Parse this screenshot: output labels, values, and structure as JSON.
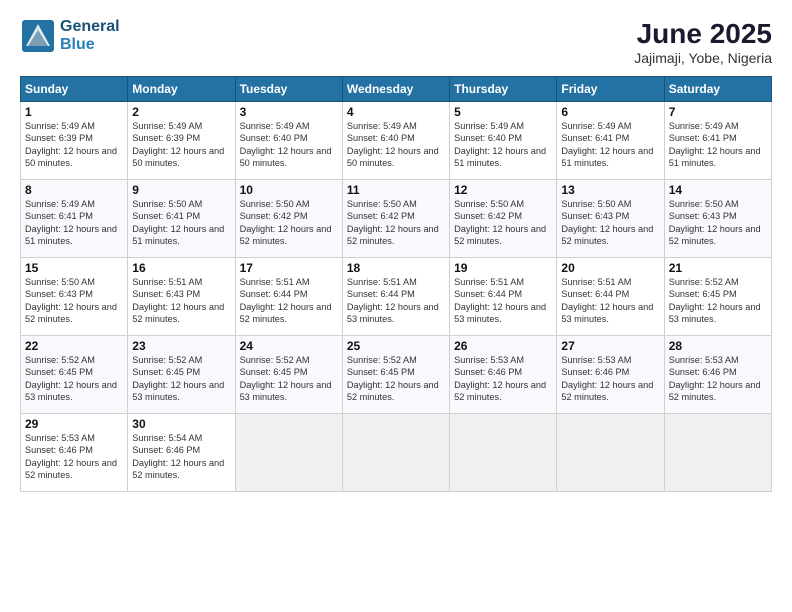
{
  "header": {
    "logo_line1": "General",
    "logo_line2": "Blue",
    "month_year": "June 2025",
    "location": "Jajimaji, Yobe, Nigeria"
  },
  "days_of_week": [
    "Sunday",
    "Monday",
    "Tuesday",
    "Wednesday",
    "Thursday",
    "Friday",
    "Saturday"
  ],
  "weeks": [
    [
      {
        "num": "1",
        "rise": "5:49 AM",
        "set": "6:39 PM",
        "daylight": "12 hours and 50 minutes"
      },
      {
        "num": "2",
        "rise": "5:49 AM",
        "set": "6:39 PM",
        "daylight": "12 hours and 50 minutes"
      },
      {
        "num": "3",
        "rise": "5:49 AM",
        "set": "6:40 PM",
        "daylight": "12 hours and 50 minutes"
      },
      {
        "num": "4",
        "rise": "5:49 AM",
        "set": "6:40 PM",
        "daylight": "12 hours and 50 minutes"
      },
      {
        "num": "5",
        "rise": "5:49 AM",
        "set": "6:40 PM",
        "daylight": "12 hours and 51 minutes"
      },
      {
        "num": "6",
        "rise": "5:49 AM",
        "set": "6:41 PM",
        "daylight": "12 hours and 51 minutes"
      },
      {
        "num": "7",
        "rise": "5:49 AM",
        "set": "6:41 PM",
        "daylight": "12 hours and 51 minutes"
      }
    ],
    [
      {
        "num": "8",
        "rise": "5:49 AM",
        "set": "6:41 PM",
        "daylight": "12 hours and 51 minutes"
      },
      {
        "num": "9",
        "rise": "5:50 AM",
        "set": "6:41 PM",
        "daylight": "12 hours and 51 minutes"
      },
      {
        "num": "10",
        "rise": "5:50 AM",
        "set": "6:42 PM",
        "daylight": "12 hours and 52 minutes"
      },
      {
        "num": "11",
        "rise": "5:50 AM",
        "set": "6:42 PM",
        "daylight": "12 hours and 52 minutes"
      },
      {
        "num": "12",
        "rise": "5:50 AM",
        "set": "6:42 PM",
        "daylight": "12 hours and 52 minutes"
      },
      {
        "num": "13",
        "rise": "5:50 AM",
        "set": "6:43 PM",
        "daylight": "12 hours and 52 minutes"
      },
      {
        "num": "14",
        "rise": "5:50 AM",
        "set": "6:43 PM",
        "daylight": "12 hours and 52 minutes"
      }
    ],
    [
      {
        "num": "15",
        "rise": "5:50 AM",
        "set": "6:43 PM",
        "daylight": "12 hours and 52 minutes"
      },
      {
        "num": "16",
        "rise": "5:51 AM",
        "set": "6:43 PM",
        "daylight": "12 hours and 52 minutes"
      },
      {
        "num": "17",
        "rise": "5:51 AM",
        "set": "6:44 PM",
        "daylight": "12 hours and 52 minutes"
      },
      {
        "num": "18",
        "rise": "5:51 AM",
        "set": "6:44 PM",
        "daylight": "12 hours and 53 minutes"
      },
      {
        "num": "19",
        "rise": "5:51 AM",
        "set": "6:44 PM",
        "daylight": "12 hours and 53 minutes"
      },
      {
        "num": "20",
        "rise": "5:51 AM",
        "set": "6:44 PM",
        "daylight": "12 hours and 53 minutes"
      },
      {
        "num": "21",
        "rise": "5:52 AM",
        "set": "6:45 PM",
        "daylight": "12 hours and 53 minutes"
      }
    ],
    [
      {
        "num": "22",
        "rise": "5:52 AM",
        "set": "6:45 PM",
        "daylight": "12 hours and 53 minutes"
      },
      {
        "num": "23",
        "rise": "5:52 AM",
        "set": "6:45 PM",
        "daylight": "12 hours and 53 minutes"
      },
      {
        "num": "24",
        "rise": "5:52 AM",
        "set": "6:45 PM",
        "daylight": "12 hours and 53 minutes"
      },
      {
        "num": "25",
        "rise": "5:52 AM",
        "set": "6:45 PM",
        "daylight": "12 hours and 52 minutes"
      },
      {
        "num": "26",
        "rise": "5:53 AM",
        "set": "6:46 PM",
        "daylight": "12 hours and 52 minutes"
      },
      {
        "num": "27",
        "rise": "5:53 AM",
        "set": "6:46 PM",
        "daylight": "12 hours and 52 minutes"
      },
      {
        "num": "28",
        "rise": "5:53 AM",
        "set": "6:46 PM",
        "daylight": "12 hours and 52 minutes"
      }
    ],
    [
      {
        "num": "29",
        "rise": "5:53 AM",
        "set": "6:46 PM",
        "daylight": "12 hours and 52 minutes"
      },
      {
        "num": "30",
        "rise": "5:54 AM",
        "set": "6:46 PM",
        "daylight": "12 hours and 52 minutes"
      },
      null,
      null,
      null,
      null,
      null
    ]
  ]
}
